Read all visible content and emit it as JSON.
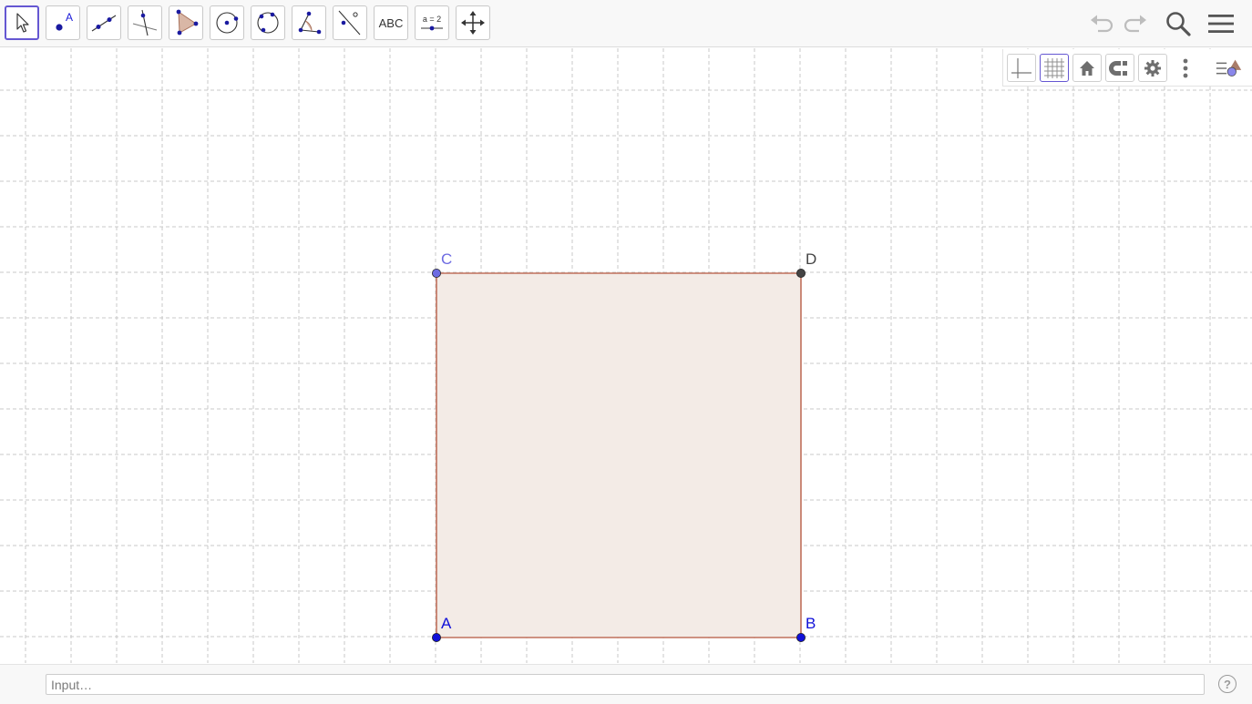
{
  "toolbar": {
    "tools": [
      {
        "id": "move",
        "icon": "arrow-cursor-icon"
      },
      {
        "id": "point",
        "icon": "point-icon",
        "label": "A"
      },
      {
        "id": "line",
        "icon": "line-through-two-points-icon"
      },
      {
        "id": "perpendicular",
        "icon": "perpendicular-line-icon"
      },
      {
        "id": "polygon",
        "icon": "polygon-icon"
      },
      {
        "id": "circle",
        "icon": "circle-center-point-icon"
      },
      {
        "id": "circle-three",
        "icon": "circle-three-points-icon"
      },
      {
        "id": "angle",
        "icon": "angle-icon"
      },
      {
        "id": "reflect",
        "icon": "reflect-about-line-icon"
      },
      {
        "id": "text",
        "icon": "text-icon",
        "label": "ABC"
      },
      {
        "id": "slider",
        "icon": "slider-icon",
        "label": "a = 2"
      },
      {
        "id": "move-view",
        "icon": "move-graphics-view-icon"
      }
    ],
    "undo_icon": "undo-icon",
    "redo_icon": "redo-icon",
    "search_icon": "search-icon",
    "menu_icon": "hamburger-menu-icon"
  },
  "style_bar": {
    "buttons": [
      "axes-toggle-icon",
      "grid-toggle-icon",
      "home-icon",
      "magnet-snap-icon",
      "gear-icon",
      "more-vertical-icon",
      "style-bar-toggle-icon"
    ],
    "grid_on": true
  },
  "graphics": {
    "grid": true,
    "axes": false,
    "points": [
      {
        "name": "A",
        "color": "#1010d8"
      },
      {
        "name": "B",
        "color": "#1010d8"
      },
      {
        "name": "C",
        "color": "#6d6be2"
      },
      {
        "name": "D",
        "color": "#444444"
      }
    ],
    "polygon": {
      "vertices": [
        "A",
        "B",
        "D",
        "C"
      ],
      "fill": "#f3ebe6",
      "stroke": "#c0705b"
    }
  },
  "input_bar": {
    "placeholder": "Input…",
    "help_label": "?"
  }
}
